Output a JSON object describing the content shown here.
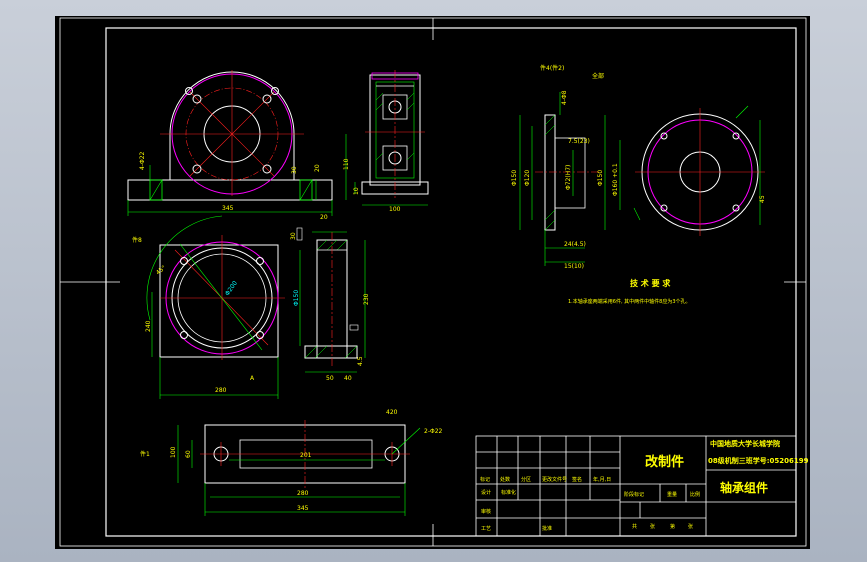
{
  "colors": {
    "sheet": "#000000",
    "frame": "#ffffff",
    "outline": "#ffffff",
    "dimension": "#00ff00",
    "centerline": "#ff2020",
    "hidden": "#ff00ff",
    "text_cyan": "#00ffff",
    "text_yellow": "#ffff00",
    "hatch": "#00ff00"
  },
  "drawing": {
    "dims_front": {
      "width": "345",
      "height": "110",
      "base_h": "20",
      "step": "30",
      "hole": "4-Φ22"
    },
    "dims_side": {
      "width": "100",
      "base": "20",
      "base_h": "10"
    },
    "dims_plan": {
      "width": "280",
      "height": "240",
      "dia": "Φ200",
      "part": "件8",
      "ang": "45°",
      "note": "A"
    },
    "dims_section": {
      "h": "230",
      "dia": "Φ150",
      "base": "50",
      "t": "40",
      "a": "4.5",
      "top": "30"
    },
    "dims_bottom": {
      "len_total": "345",
      "len_inner": "280",
      "slot": "201",
      "height": "100",
      "h2": "60",
      "hole": "2-Φ22",
      "r": "420",
      "part": "件1"
    },
    "dims_cover": {
      "label_part": "件4(件2)",
      "label_dia": "4-Φ8",
      "label_b": "全部",
      "d1": "Φ150",
      "d2": "Φ120",
      "d3": "Φ150",
      "d4": "Φ72(H7)",
      "d5": "Φ160 +0.1",
      "t1": "7.5(23)",
      "t2": "24(4.5)",
      "t3": "15(10)"
    },
    "dims_circle": {
      "dia": "45"
    }
  },
  "notes": {
    "title": "技 术 要 求",
    "line1": "1.本轴承座两端采用6件, 其中两件中轴件8应为3个孔。"
  },
  "title_block": {
    "title_main": "改制件",
    "school_line1": "中国地质大学长城学院",
    "school_line2": "08级机制三班学号:05206199",
    "part_name": "轴承组件",
    "row_labels": [
      "标记",
      "处数",
      "分区",
      "更改文件号",
      "签名",
      "年,月,日"
    ],
    "sign_labels": [
      "设计",
      "标准化",
      "阶段标记",
      "重量",
      "比例"
    ],
    "approve_labels": [
      "审核",
      "工艺",
      "批准"
    ],
    "sheet_labels": [
      "共",
      "张",
      "第",
      "张"
    ]
  }
}
